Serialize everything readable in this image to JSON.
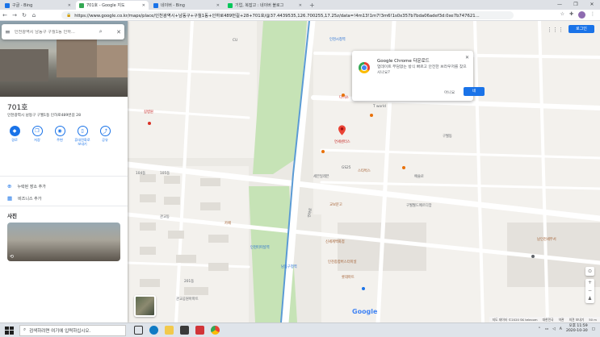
{
  "browser": {
    "tabs": [
      {
        "label": "구글 - Bing",
        "active": false,
        "color": "#1a73e8"
      },
      {
        "label": "701호 - Google 지도",
        "active": true,
        "color": "#34a853"
      },
      {
        "label": "네이버 - Bing",
        "active": false,
        "color": "#1a73e8"
      },
      {
        "label": "기업, 복잡고 : 네이버 블로그",
        "active": false,
        "color": "#03c75a"
      }
    ],
    "url": "https://www.google.co.kr/maps/place/인천광역시+남동구+구월1동+인하로489번길+28+701호/@37.4439535,126.700255,17.25z/data=!4m13!1m7!3m6!1s0x357b7bda06adef3d:0xe7b747621...",
    "window_controls": [
      "—",
      "❐",
      "✕"
    ]
  },
  "panel": {
    "search_placeholder": "인천광역시 남동구 구월1동 인하...",
    "place_name": "701호",
    "address": "인천광역시 남동구 구월1동 인하로489번길 28",
    "actions": [
      {
        "label": "경로",
        "icon": "◆",
        "filled": true
      },
      {
        "label": "저장",
        "icon": "❐",
        "filled": false
      },
      {
        "label": "주변",
        "icon": "◉",
        "filled": false
      },
      {
        "label": "휴대전화로 보내기",
        "icon": "▯",
        "filled": false
      },
      {
        "label": "공유",
        "icon": "⤴",
        "filled": false
      }
    ],
    "links": [
      {
        "label": "누락된 장소 추가",
        "icon": "⊕"
      },
      {
        "label": "비즈니스 추가",
        "icon": "▦"
      }
    ],
    "photos_label": "사진"
  },
  "map": {
    "apps_icon": "⋮⋮⋮",
    "login_button": "로그인",
    "labels": [
      {
        "text": "남동구청역",
        "cls": "blue"
      },
      {
        "text": "인천터미널역",
        "cls": "blue"
      },
      {
        "text": "신세계백화점",
        "cls": "brown"
      },
      {
        "text": "인천종합버스터미널",
        "cls": "brown"
      },
      {
        "text": "연세센터스",
        "cls": "red"
      },
      {
        "text": "T world",
        "cls": ""
      },
      {
        "text": "다이소",
        "cls": "red"
      },
      {
        "text": "롯데마트",
        "cls": "brown"
      },
      {
        "text": "GS25",
        "cls": ""
      },
      {
        "text": "세븐일레븐",
        "cls": ""
      },
      {
        "text": "인하로",
        "cls": ""
      },
      {
        "text": "예술로",
        "cls": ""
      },
      {
        "text": "남인천세무서",
        "cls": "brown"
      },
      {
        "text": "인천시청역",
        "cls": "blue"
      },
      {
        "text": "구월동",
        "cls": ""
      },
      {
        "text": "관교동",
        "cls": ""
      },
      {
        "text": "104동",
        "cls": ""
      },
      {
        "text": "105동",
        "cls": ""
      },
      {
        "text": "201동",
        "cls": ""
      },
      {
        "text": "관교공원아파트",
        "cls": ""
      },
      {
        "text": "카페",
        "cls": "brown"
      },
      {
        "text": "CU",
        "cls": ""
      },
      {
        "text": "교보문고",
        "cls": "brown"
      },
      {
        "text": "스타벅스",
        "cls": "brown"
      },
      {
        "text": "구월월드메르디앙",
        "cls": ""
      },
      {
        "text": "길병원",
        "cls": "red"
      }
    ],
    "google_logo": "Google",
    "footer": [
      "지도 데이터 ©2020 SK telecom",
      "대한민국",
      "약관",
      "의견 보내기",
      "50 m"
    ]
  },
  "chrome_dialog": {
    "title": "Google Chrome 다운로드",
    "body": "업데이트 부담없는 방식 빠르고 안전한 브라우저를 찾으시나요?",
    "no": "아니요",
    "yes": "네"
  },
  "taskbar": {
    "search_placeholder": "검색하려면 여기에 입력하십시오.",
    "time": "오후 11:59",
    "date": "2020-10-30",
    "lang": "A"
  }
}
